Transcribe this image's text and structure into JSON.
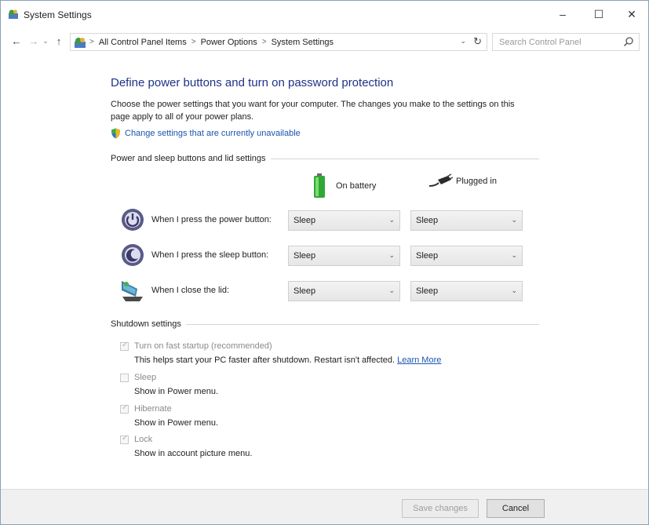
{
  "window": {
    "title": "System Settings",
    "controls": {
      "minimize": "–",
      "maximize": "☐",
      "close": "✕"
    }
  },
  "nav": {
    "back": "←",
    "forward": "→",
    "recent": "⌄",
    "up": "↑",
    "breadcrumb": [
      "All Control Panel Items",
      "Power Options",
      "System Settings"
    ],
    "breadcrumb_sep": ">",
    "dropdown": "⌄",
    "refresh": "↻",
    "search_placeholder": "Search Control Panel"
  },
  "main": {
    "heading": "Define power buttons and turn on password protection",
    "description": "Choose the power settings that you want for your computer. The changes you make to the settings on this page apply to all of your power plans.",
    "unavailable_link": "Change settings that are currently unavailable",
    "power_group_label": "Power and sleep buttons and lid settings",
    "columns": {
      "battery": "On battery",
      "plugged": "Plugged in"
    },
    "rows": [
      {
        "label": "When I press the power button:",
        "battery": "Sleep",
        "plugged": "Sleep",
        "icon": "power-button-icon"
      },
      {
        "label": "When I press the sleep button:",
        "battery": "Sleep",
        "plugged": "Sleep",
        "icon": "sleep-button-icon"
      },
      {
        "label": "When I close the lid:",
        "battery": "Sleep",
        "plugged": "Sleep",
        "icon": "laptop-lid-icon"
      }
    ],
    "shutdown_group_label": "Shutdown settings",
    "shutdown": [
      {
        "label": "Turn on fast startup (recommended)",
        "desc": "This helps start your PC faster after shutdown. Restart isn't affected.",
        "link": "Learn More",
        "checked": true
      },
      {
        "label": "Sleep",
        "desc": "Show in Power menu.",
        "checked": false
      },
      {
        "label": "Hibernate",
        "desc": "Show in Power menu.",
        "checked": true
      },
      {
        "label": "Lock",
        "desc": "Show in account picture menu.",
        "checked": true
      }
    ]
  },
  "footer": {
    "save": "Save changes",
    "cancel": "Cancel"
  },
  "colors": {
    "heading": "#1e3287",
    "link": "#1a55b0",
    "battery_green": "#3fbf3f"
  }
}
